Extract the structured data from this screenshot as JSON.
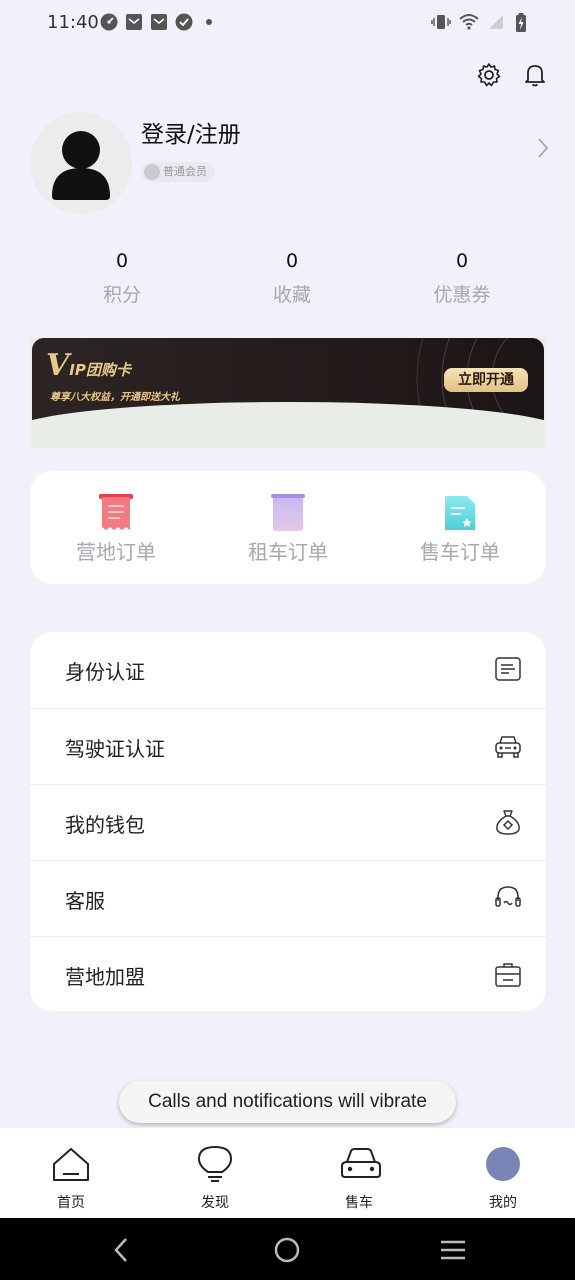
{
  "status_bar": {
    "time": "11:40",
    "left_icons": [
      "speedometer-icon",
      "mail-icon",
      "mail-icon",
      "check-circle-icon",
      "dot-icon"
    ],
    "right_icons": [
      "vibrate-icon",
      "wifi-icon",
      "signal-icon",
      "battery-charging-icon"
    ]
  },
  "header": {
    "actions": [
      "settings-gear-icon",
      "notification-bell-icon"
    ]
  },
  "profile": {
    "login_label": "登录/注册",
    "member_level": "普通会员"
  },
  "stats": [
    {
      "value": "0",
      "label": "积分"
    },
    {
      "value": "0",
      "label": "收藏"
    },
    {
      "value": "0",
      "label": "优惠券"
    }
  ],
  "vip_banner": {
    "logo_v": "V",
    "logo_text": "IP团购卡",
    "subtitle": "尊享八大权益，开通即送大礼",
    "button_label": "立即开通",
    "accent_color": "#e8c88a"
  },
  "orders": [
    {
      "label": "营地订单",
      "icon": "camp-order-icon",
      "color": "#f0616b"
    },
    {
      "label": "租车订单",
      "icon": "rental-order-icon",
      "color": "#b9a7ee"
    },
    {
      "label": "售车订单",
      "icon": "sale-order-icon",
      "color": "#5fd6dd"
    }
  ],
  "menu": [
    {
      "label": "身份认证",
      "icon": "id-card-icon"
    },
    {
      "label": "驾驶证认证",
      "icon": "car-icon"
    },
    {
      "label": "我的钱包",
      "icon": "money-bag-icon"
    },
    {
      "label": "客服",
      "icon": "headset-icon"
    },
    {
      "label": "营地加盟",
      "icon": "briefcase-icon"
    }
  ],
  "toast": {
    "message": "Calls and notifications will vibrate"
  },
  "tab_bar": [
    {
      "label": "首页",
      "icon": "home-icon",
      "active": false
    },
    {
      "label": "发现",
      "icon": "lightbulb-icon",
      "active": false
    },
    {
      "label": "售车",
      "icon": "car-front-icon",
      "active": false
    },
    {
      "label": "我的",
      "icon": "profile-dot-icon",
      "active": true,
      "color": "#7b84b7"
    }
  ],
  "system_nav": [
    "back-icon",
    "home-circle-icon",
    "recents-menu-icon"
  ]
}
